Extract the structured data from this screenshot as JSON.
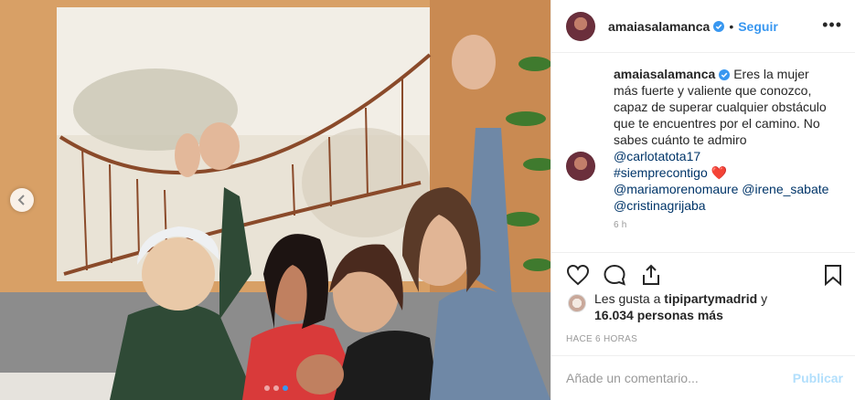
{
  "post": {
    "username": "amaiasalamanca",
    "separator": "•",
    "follow_label": "Seguir",
    "more_label": "•••",
    "caption": {
      "username": "amaiasalamanca",
      "text": "Eres la mujer más fuerte y valiente que conozco, capaz de superar cualquier obstáculo que te encuentres por el camino. No sabes cuánto te admiro",
      "mention_1": "@carlotatota17",
      "hashtag": "#siemprecontigo",
      "heart": "❤️",
      "mentions_line": "@mariamorenomaure @irene_sabate",
      "mention_last": "@cristinagrijaba",
      "age": "6 h"
    },
    "likes": {
      "prefix": "Les gusta a ",
      "liker": "tipipartymadrid",
      "conj": " y",
      "others": "16.034 personas más"
    },
    "timestamp": "HACE 6 HORAS",
    "comment_placeholder": "Añade un comentario...",
    "publish_label": "Publicar"
  },
  "carousel": {
    "dots": 3,
    "active_index": 2
  },
  "icons": [
    "chevron-left-icon",
    "verified-badge-icon",
    "heart-icon",
    "comment-icon",
    "share-icon",
    "bookmark-icon",
    "more-icon"
  ],
  "colors": {
    "accent": "#3897f0",
    "link": "#003569",
    "muted": "#999999",
    "heart": "#ed4956",
    "disabled_publish": "#b2dffc"
  }
}
